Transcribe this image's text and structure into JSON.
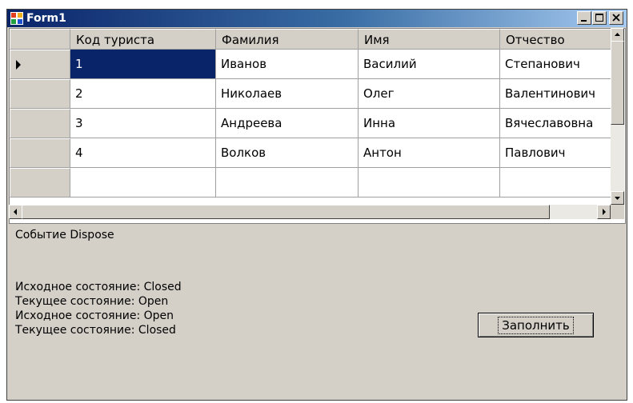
{
  "window": {
    "title": "Form1"
  },
  "grid": {
    "columns": [
      "Код туриста",
      "Фамилия",
      "Имя",
      "Отчество"
    ],
    "rows": [
      [
        "1",
        "Иванов",
        "Василий",
        "Степанович"
      ],
      [
        "2",
        "Николаев",
        "Олег",
        "Валентинович"
      ],
      [
        "3",
        "Андреева",
        "Инна",
        "Вячеславовна"
      ],
      [
        "4",
        "Волков",
        "Антон",
        "Павлович"
      ]
    ],
    "selected_row": 0
  },
  "event_label": "Событие Dispose",
  "log_lines": [
    "Исходное состояние: Closed",
    "Текущее состояние: Open",
    "Исходное состояние: Open",
    "Текущее состояние: Closed"
  ],
  "fill_button": {
    "label": "Заполнить"
  },
  "colors": {
    "titlebar_start": "#0a246a",
    "titlebar_end": "#a6caf0",
    "form_background": "#d4d0c8",
    "selection": "#0a246a"
  },
  "icons": [
    "app-icon",
    "minimize-icon",
    "maximize-icon",
    "close-icon",
    "row-pointer-icon",
    "arrow-up-icon",
    "arrow-down-icon",
    "arrow-left-icon",
    "arrow-right-icon"
  ]
}
